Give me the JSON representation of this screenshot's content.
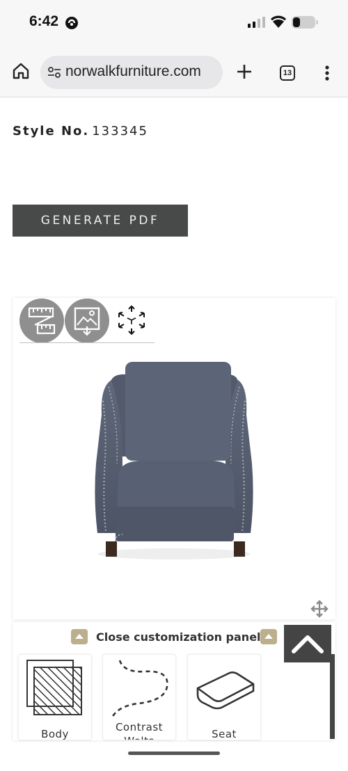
{
  "status_bar": {
    "time": "6:42"
  },
  "browser": {
    "url": "norwalkfurniture.com",
    "tab_count": "13"
  },
  "product": {
    "style_label": "Style No.",
    "style_number": "133345"
  },
  "actions": {
    "generate_pdf": "GENERATE PDF"
  },
  "customization": {
    "toggle_label": "Close customization panel",
    "options": [
      {
        "label": "Body"
      },
      {
        "label": "Contrast Welts"
      },
      {
        "label": "Seat"
      }
    ]
  },
  "colors": {
    "pdf_button_bg": "#474a49",
    "toggle_accent": "#bcaf8b",
    "tool_circle": "#8f8f8f",
    "fabric": "#5a6273",
    "scroll_button": "#444444"
  }
}
